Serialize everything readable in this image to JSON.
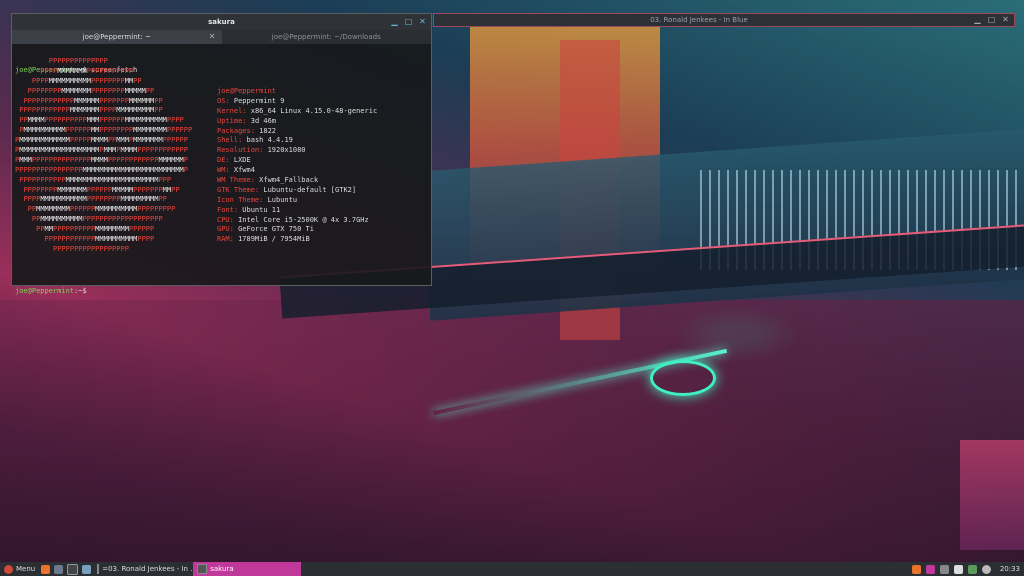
{
  "background_window": {
    "title": "03. Ronald Jenkees - In Blue"
  },
  "terminal": {
    "title": "sakura",
    "tabs": [
      {
        "label": "joe@Peppermint: ~",
        "active": true
      },
      {
        "label": "joe@Peppermint: ~/Downloads",
        "active": false
      }
    ],
    "prompt_user": "joe@Peppermint",
    "prompt_path": ":~$",
    "command": " screenfetch",
    "logo_lines": [
      "        PPPPPPPPPPPPPP",
      "      PPPPMMMMMMMPPPPPPPPPPP",
      "    PPPPMMMMMMMMMMPPPPPPPPMMPP",
      "   PPPPPPPPMMMMMMMPPPPPPPPMMMMMPP",
      "  PPPPPPPPPPPPMMMMMMPPPPPPPMMMMMMPP",
      " PPPPPPPPPPPPMMMMMMMPPPPMMMMMMMMMPP",
      " PPMMMMPPPPPPPPPPMMMPPPPPPMMMMMMMMMMPPPP",
      " PMMMMMMMMMMPPPPPPMMPPPPPPPPMMMMMMMMPPPPPP",
      "PMMMMMMMMMMMMPPPPPMMMMPPMMMPMMMMMMMPPPPPP",
      "PMMMMMMMMMMMMMMMMMMMPMMMPMMMMPPPPPPPPPPPP",
      "PMMMPPPPPPPPPPPPPPMMMMPPPPPPPPPPPPMMMMMMP",
      "PPPPPPPPPPPPPPPPMMMMMMMMMMMMMMMMMMMMMMMMP",
      " PPPPPPPPPPPMMMMMMMMMMMMMMMMMMMMMMPPP",
      "  PPPPPPPPMMMMMMMPPPPPPMMMMMPPPPPPPMMPP",
      "  PPPPMMMMMMMMMMMPPPPPPPPMMMMMMMMMPP",
      "   PPMMMMMMMMPPPPPPMMMMMMMMMMPPPPPPPPP",
      "    PPMMMMMMMMMMPPPPPPPPPPPPPPPPPPP",
      "     PPMMPPPPPPPPPPMMMMMMMMPPPPPP",
      "       PPPPPPPPPPPPMMMMMMMMMMPPPP",
      "         PPPPPPPPPPPPPPPPPP"
    ],
    "info": [
      {
        "key": "joe@Peppermint",
        "value": ""
      },
      {
        "key": "OS:",
        "value": " Peppermint 9"
      },
      {
        "key": "Kernel:",
        "value": " x86_64 Linux 4.15.0-48-generic"
      },
      {
        "key": "Uptime:",
        "value": " 3d 46m"
      },
      {
        "key": "Packages:",
        "value": " 1822"
      },
      {
        "key": "Shell:",
        "value": " bash 4.4.19"
      },
      {
        "key": "Resolution:",
        "value": " 1920x1080"
      },
      {
        "key": "DE:",
        "value": " LXDE"
      },
      {
        "key": "WM:",
        "value": " Xfwm4"
      },
      {
        "key": "WM Theme:",
        "value": " Xfwm4_Fallback"
      },
      {
        "key": "GTK Theme:",
        "value": " Lubuntu-default [GTK2]"
      },
      {
        "key": "Icon Theme:",
        "value": " Lubuntu"
      },
      {
        "key": "Font:",
        "value": " Ubuntu 11"
      },
      {
        "key": "CPU:",
        "value": " Intel Core i5-2500K @ 4x 3.7GHz"
      },
      {
        "key": "GPU:",
        "value": " GeForce GTX 750 Ti"
      },
      {
        "key": "RAM:",
        "value": " 1789MiB / 7954MiB"
      }
    ]
  },
  "taskbar": {
    "menu_label": "Menu",
    "tasks": [
      {
        "label": "=03. Ronald Jenkees - In ..."
      },
      {
        "label": "sakura"
      }
    ],
    "clock": "20:33"
  },
  "colors": {
    "accent": "#c0399a",
    "logo_red": "#e8453c",
    "prompt_green": "#7fd05a"
  }
}
